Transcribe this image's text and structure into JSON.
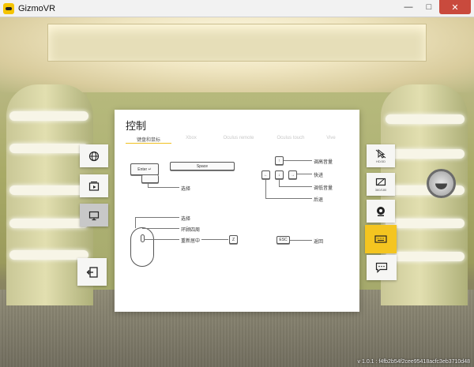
{
  "window": {
    "title": "GizmoVR",
    "minimize_glyph": "—",
    "maximize_glyph": "□",
    "close_glyph": "✕"
  },
  "panel": {
    "title": "控制",
    "tabs": [
      {
        "label": "键盘和鼠标",
        "active": true
      },
      {
        "label": "Xbox",
        "active": false
      },
      {
        "label": "Oculus remote",
        "active": false
      },
      {
        "label": "Oculus touch",
        "active": false
      },
      {
        "label": "Vive",
        "active": false
      }
    ],
    "keyboard": {
      "enter_key": "Enter ↵",
      "space_key": "Space",
      "enter_label": "选择",
      "up_key": "↑",
      "left_key": "←",
      "down_key": "↓",
      "right_key": "→",
      "up_label": "调高音量",
      "right_label": "快进",
      "down_label": "调低音量",
      "left_label": "后退"
    },
    "mouse": {
      "select_label": "选择",
      "look_label": "环顾四周",
      "recenter_label": "重新居中",
      "recenter_key": "Z",
      "esc_key": "ESC",
      "esc_label": "返回"
    }
  },
  "left_menu": [
    {
      "icon": "globe-icon",
      "selected": false
    },
    {
      "icon": "media-folder-icon",
      "selected": false
    },
    {
      "icon": "monitor-icon",
      "selected": true
    },
    {
      "icon": "exit-icon",
      "selected": false
    }
  ],
  "right_menu": [
    {
      "icon": "pointer-off-icon",
      "sub": "HD/3D"
    },
    {
      "icon": "display-mode-icon",
      "sub": "360/180"
    },
    {
      "icon": "eye-icon",
      "sub": ""
    },
    {
      "icon": "keyboard-icon",
      "sub": ""
    },
    {
      "icon": "chat-icon",
      "sub": ""
    }
  ],
  "colors": {
    "accent": "#f4c520",
    "panel_bg": "#ffffff",
    "selected_button": "#c8c8c8"
  },
  "version": "v 1.0.1 : f4fb2b54f2cee95418acfc3eb3710d48"
}
